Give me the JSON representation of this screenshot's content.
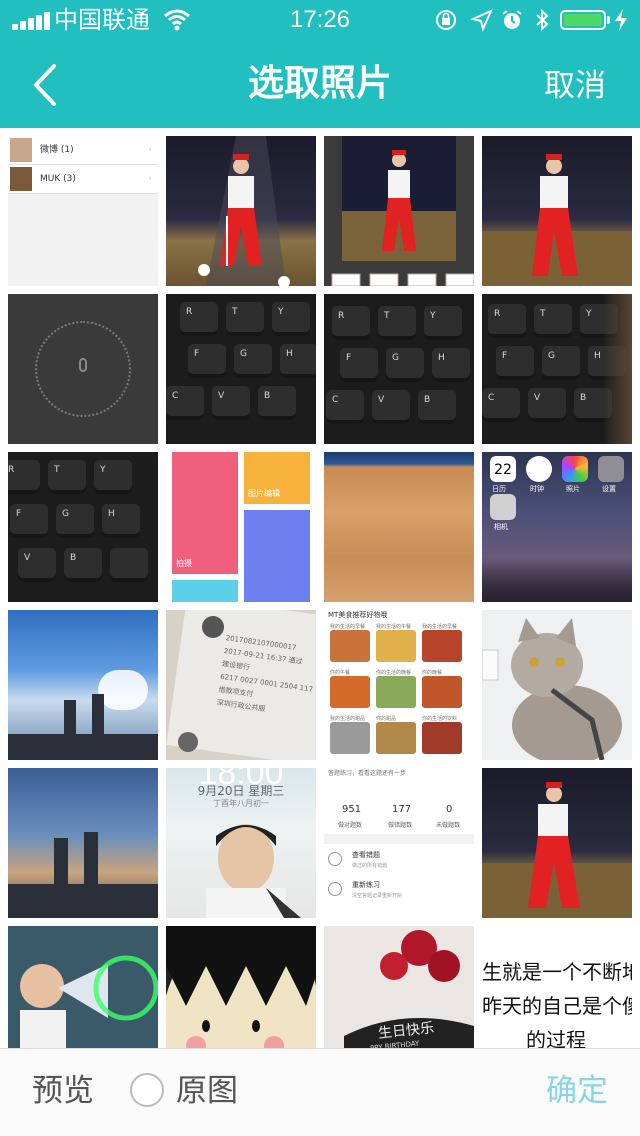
{
  "status_bar": {
    "carrier": "中国联通",
    "time": "17:26"
  },
  "nav": {
    "title": "选取照片",
    "cancel_label": "取消"
  },
  "photos": {
    "album_rows": [
      {
        "label": "微博 (1)"
      },
      {
        "label": "MUK (3)"
      }
    ],
    "keyboard_keys": [
      "R",
      "T",
      "Y",
      "F",
      "G",
      "H",
      "C",
      "V",
      "B"
    ],
    "settings_tile": {
      "label1": "图片编辑",
      "label2": "拍摄"
    },
    "ios_home": {
      "date": "22",
      "apps": [
        "日历",
        "时钟",
        "照片",
        "设置",
        "相机"
      ]
    },
    "chat_tile": {
      "t1": "2017082107000017",
      "t2": "2017-09-21 16:37 通过",
      "t3": "建设银行",
      "t4": "6217 0027 0001 2504 117",
      "t5": "借款项支付",
      "t6": "深圳行政公共服"
    },
    "lock_tile": {
      "time": "18:00",
      "date": "9月20日 星期三",
      "lunar": "丁酉年八月初一"
    },
    "stats_tile": {
      "header": "答题练习，看看这题还有一步",
      "n1": "951",
      "n2": "177",
      "n3": "0",
      "l1": "做对题数",
      "l2": "做错题数",
      "l3": "未做题数",
      "item1": "查看错题",
      "item1_sub": "做过的所有错题",
      "item2": "重新练习",
      "item2_sub": "清空答题记录重新开始"
    },
    "food_tile": {
      "header": "MT美食推荐好物哦",
      "captions": [
        "我的生活的早餐",
        "我的生活的午餐",
        "我的生活的早餐",
        "你的午餐",
        "你的生活的晚餐",
        "你的晚餐",
        "我的生活的甜品",
        "你的甜品",
        "你的生活的饮料"
      ]
    },
    "cake_tile": {
      "text": "生日快乐",
      "sub": "PPY BIRTHDAY"
    },
    "text_tile": {
      "line1": "生就是一个不断地",
      "line2": "昨天的自己是个傻",
      "line3": "的过程"
    }
  },
  "bottom_bar": {
    "preview_label": "预览",
    "original_label": "原图",
    "confirm_label": "确定"
  },
  "colors": {
    "accent": "#21bfbf",
    "confirm_disabled": "#88d4e8"
  }
}
